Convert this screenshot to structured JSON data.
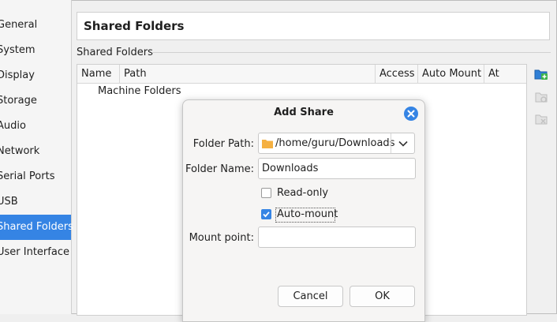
{
  "sidebar": {
    "items": [
      {
        "label": "General"
      },
      {
        "label": "System"
      },
      {
        "label": "Display"
      },
      {
        "label": "Storage"
      },
      {
        "label": "Audio"
      },
      {
        "label": "Network"
      },
      {
        "label": "Serial Ports"
      },
      {
        "label": "USB"
      },
      {
        "label": "Shared Folders"
      },
      {
        "label": "User Interface"
      }
    ],
    "active": "Shared Folders"
  },
  "header": {
    "title": "Shared Folders"
  },
  "section": {
    "label": "Shared Folders"
  },
  "table": {
    "columns": [
      "Name",
      "Path",
      "Access",
      "Auto Mount",
      "At"
    ],
    "rows": [
      {
        "name": "Machine Folders"
      }
    ]
  },
  "tools": [
    "add-share-icon",
    "edit-share-icon",
    "remove-share-icon"
  ],
  "dialog": {
    "title": "Add Share",
    "folder_path_label": "Folder Path:",
    "folder_path_value": "/home/guru/Downloads",
    "folder_name_label": "Folder Name:",
    "folder_name_value": "Downloads",
    "readonly_label": "Read-only",
    "readonly_checked": false,
    "automount_label": "Auto-mount",
    "automount_checked": true,
    "mount_point_label": "Mount point:",
    "mount_point_value": "",
    "cancel_label": "Cancel",
    "ok_label": "OK"
  },
  "colors": {
    "accent": "#3584e4",
    "folder": "#f5b041"
  }
}
